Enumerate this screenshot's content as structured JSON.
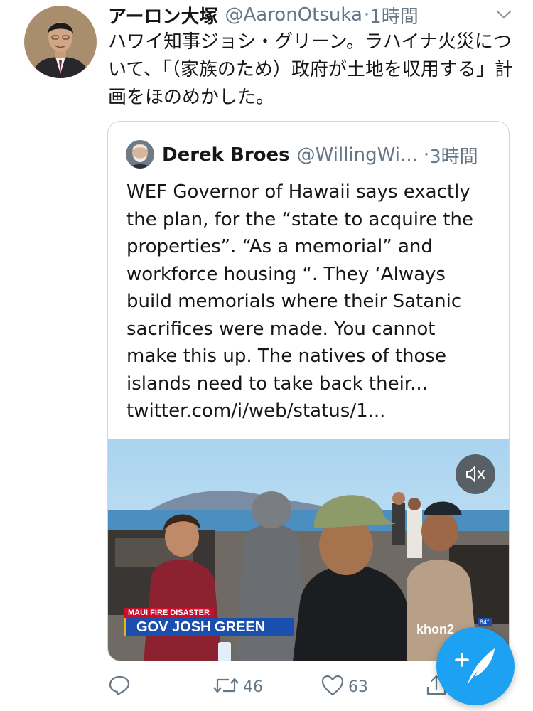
{
  "tweet": {
    "author_name": "アーロン大塚",
    "handle": "@AaronOtsuka",
    "separator": "·",
    "time": "1時間",
    "text": "ハワイ知事ジョシ・グリーン。ラハイナ火災について、「（家族のため）政府が土地を収用する」計画をほのめかした。"
  },
  "quote": {
    "author_name": "Derek Broes",
    "handle": "@WillingWi...",
    "separator": "·",
    "time": "3時間",
    "lines": [
      "WEF Governor of Hawaii says exactly",
      "the plan, for the “state to acquire the",
      "properties”. “As a memorial” and",
      "workforce housing “. They ‘Always",
      "build memorials where their Satanic",
      "sacrifices were made. You cannot",
      "make this up. The natives of those",
      "islands need to take back their...",
      "twitter.com/i/web/status/1..."
    ],
    "media": {
      "chyron_top": "MAUI FIRE DISASTER",
      "chyron_main": "GOV JOSH GREEN",
      "station_logo": "khon2",
      "temperature": "84°"
    }
  },
  "actions": {
    "reply_count": "",
    "retweet_count": "46",
    "like_count": "63"
  },
  "icons": {
    "menu": "chevron-down-icon",
    "mute": "volume-mute-icon",
    "reply": "reply-icon",
    "retweet": "retweet-icon",
    "like": "heart-icon",
    "share": "share-icon",
    "compose": "compose-tweet-icon"
  },
  "colors": {
    "accent": "#1da1f2",
    "secondary_text": "#657786",
    "border": "#ccd6dd",
    "chyron_red": "#c8102e",
    "chyron_blue": "#1b4fae"
  }
}
